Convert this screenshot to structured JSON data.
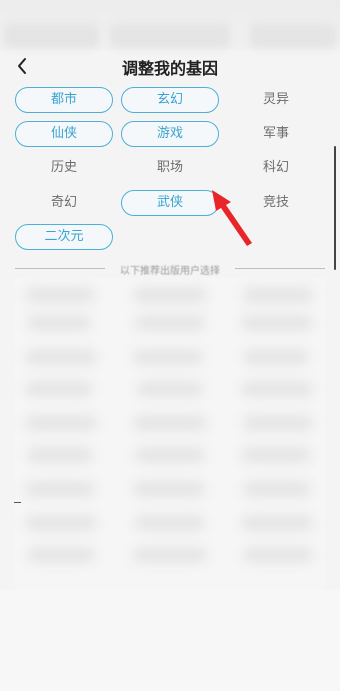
{
  "header": {
    "title": "调整我的基因",
    "back_icon": "chevron-left-icon"
  },
  "tags": [
    {
      "label": "都市",
      "selected": true
    },
    {
      "label": "玄幻",
      "selected": true
    },
    {
      "label": "灵异",
      "selected": false
    },
    {
      "label": "仙侠",
      "selected": true
    },
    {
      "label": "游戏",
      "selected": true
    },
    {
      "label": "军事",
      "selected": false
    },
    {
      "label": "历史",
      "selected": false
    },
    {
      "label": "职场",
      "selected": false
    },
    {
      "label": "科幻",
      "selected": false
    },
    {
      "label": "奇幻",
      "selected": false
    },
    {
      "label": "武侠",
      "selected": true
    },
    {
      "label": "竞技",
      "selected": false
    },
    {
      "label": "二次元",
      "selected": true
    }
  ],
  "recommend": {
    "divider_label": "以下推荐出版用户选择"
  },
  "colors": {
    "accent": "#3aa3cf",
    "annotation_arrow": "#e8262a"
  }
}
